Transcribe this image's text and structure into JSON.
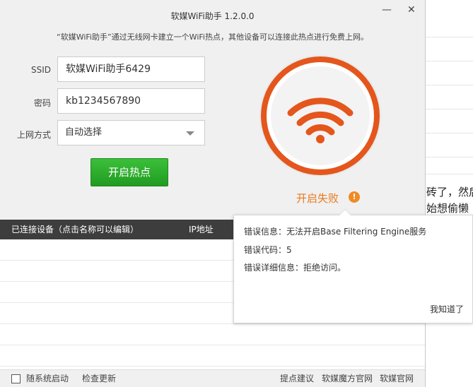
{
  "window": {
    "title": "软媒WiFi助手 1.2.0.0",
    "min": "—",
    "close": "✕",
    "hint": "“软媒WiFi助手”通过无线网卡建立一个WiFi热点，其他设备可以连接此热点进行免费上网。"
  },
  "form": {
    "ssid_label": "SSID",
    "ssid_value": "软媒WiFi助手6429",
    "pwd_label": "密码",
    "pwd_value": "kb1234567890",
    "mode_label": "上网方式",
    "mode_value": "自动选择",
    "start": "开启热点"
  },
  "status": {
    "text": "开启失败",
    "icon": "!",
    "color": "#e87a1e"
  },
  "devices": {
    "col1": "已连接设备（点击名称可以编辑）",
    "col2": "IP地址"
  },
  "footer": {
    "autostart": "随系统启动",
    "update": "检查更新",
    "feedback": "提点建议",
    "site": "软媒魔方官网",
    "ruanmei": "软媒官网"
  },
  "popup": {
    "info": "错误信息：无法开启Base Filtering Engine服务",
    "code": "错误代码：5",
    "detail": "错误详细信息：拒绝访问。",
    "ok": "我知道了"
  },
  "background": {
    "line1": "砖了，然后",
    "line2": "始想偷懒"
  }
}
